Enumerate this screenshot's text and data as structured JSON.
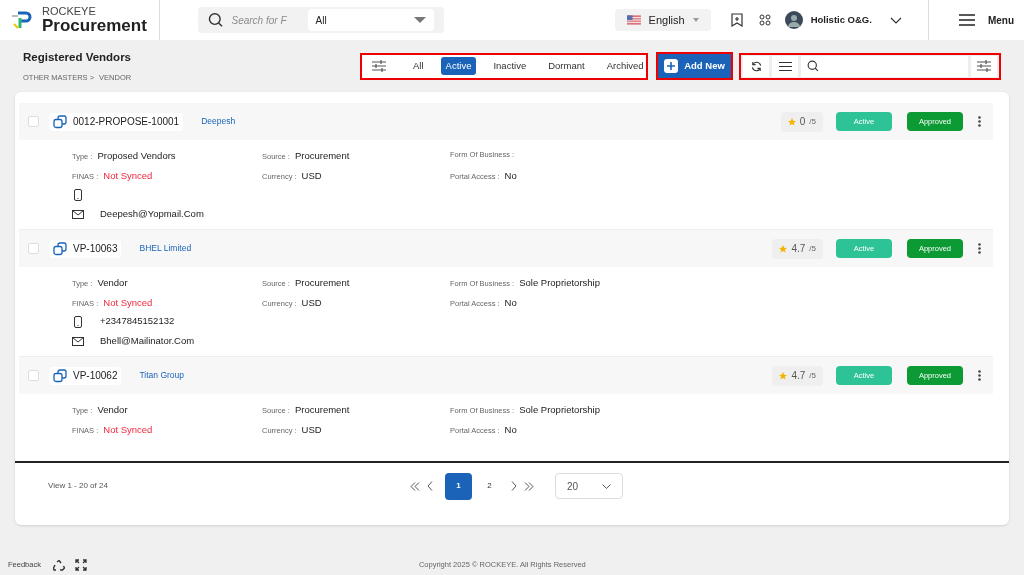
{
  "header": {
    "brand_top": "ROCKEYE",
    "brand": "Procurement",
    "search": {
      "placeholder": "Search for F"
    },
    "scope": "All",
    "language": "English",
    "user": "Holistic O&G.",
    "menu": "Menu"
  },
  "page": {
    "title": "Registered Vendors",
    "breadcrumb": [
      "OTHER MASTERS >",
      "VENDOR"
    ]
  },
  "filters": [
    {
      "label": "All",
      "selected": false
    },
    {
      "label": "Active",
      "selected": true
    },
    {
      "label": "Inactive",
      "selected": false
    },
    {
      "label": "Dormant",
      "selected": false
    },
    {
      "label": "Archived",
      "selected": false
    }
  ],
  "add_button": "Add New",
  "vendors": [
    {
      "checked": false,
      "code": "0012-PROPOSE-10001",
      "name": "Deepesh",
      "rating": "0",
      "rating_max": "/5",
      "status": "Active",
      "approval": "Approved",
      "fields": [
        {
          "label": "Type :",
          "value": "Proposed Vendors"
        },
        {
          "label": "Source :",
          "value": "Procurement"
        },
        {
          "label": "Form Of Business :"
        },
        {
          "label": "FINAS :",
          "value": "Not Synced",
          "alert": true
        },
        {
          "label": "Currency :",
          "value": "USD"
        },
        {
          "label": "Portal Access :",
          "value": "No"
        }
      ],
      "show_phone": true,
      "email": "Deepesh@Yopmail.Com"
    },
    {
      "checked": false,
      "code": "VP-10063",
      "name": "BHEL Limited",
      "rating": "4.7",
      "rating_max": "/5",
      "status": "Active",
      "approval": "Approved",
      "fields": [
        {
          "label": "Type :",
          "value": "Vendor"
        },
        {
          "label": "Source :",
          "value": "Procurement"
        },
        {
          "label": "Form Of Business :",
          "value": "Sole Proprietorship"
        },
        {
          "label": "FINAS :",
          "value": "Not Synced",
          "alert": true
        },
        {
          "label": "Currency :",
          "value": "USD"
        },
        {
          "label": "Portal Access :",
          "value": "No"
        }
      ],
      "phone": "+2347845152132",
      "email": "Bhell@Mailinator.Com"
    },
    {
      "checked": false,
      "code": "VP-10062",
      "name": "Titan Group",
      "rating": "4.7",
      "rating_max": "/5",
      "status": "Active",
      "approval": "Approved",
      "fields": [
        {
          "label": "Type :",
          "value": "Vendor"
        },
        {
          "label": "Source :",
          "value": "Procurement"
        },
        {
          "label": "Form Of Business :",
          "value": "Sole Proprietorship"
        },
        {
          "label": "FINAS :",
          "value": "Not Synced",
          "alert": true
        },
        {
          "label": "Currency :",
          "value": "USD"
        },
        {
          "label": "Portal Access :",
          "value": "No"
        }
      ]
    }
  ],
  "pagination": {
    "summary": "View 1 - 20 of 24",
    "pages": [
      {
        "label": "1",
        "selected": true
      },
      {
        "label": "2",
        "selected": false
      }
    ],
    "page_size": "20"
  },
  "footer": {
    "feedback": "Feedback",
    "copyright": "Copyright 2025 © ROCKEYE. All Rights Reserved"
  }
}
